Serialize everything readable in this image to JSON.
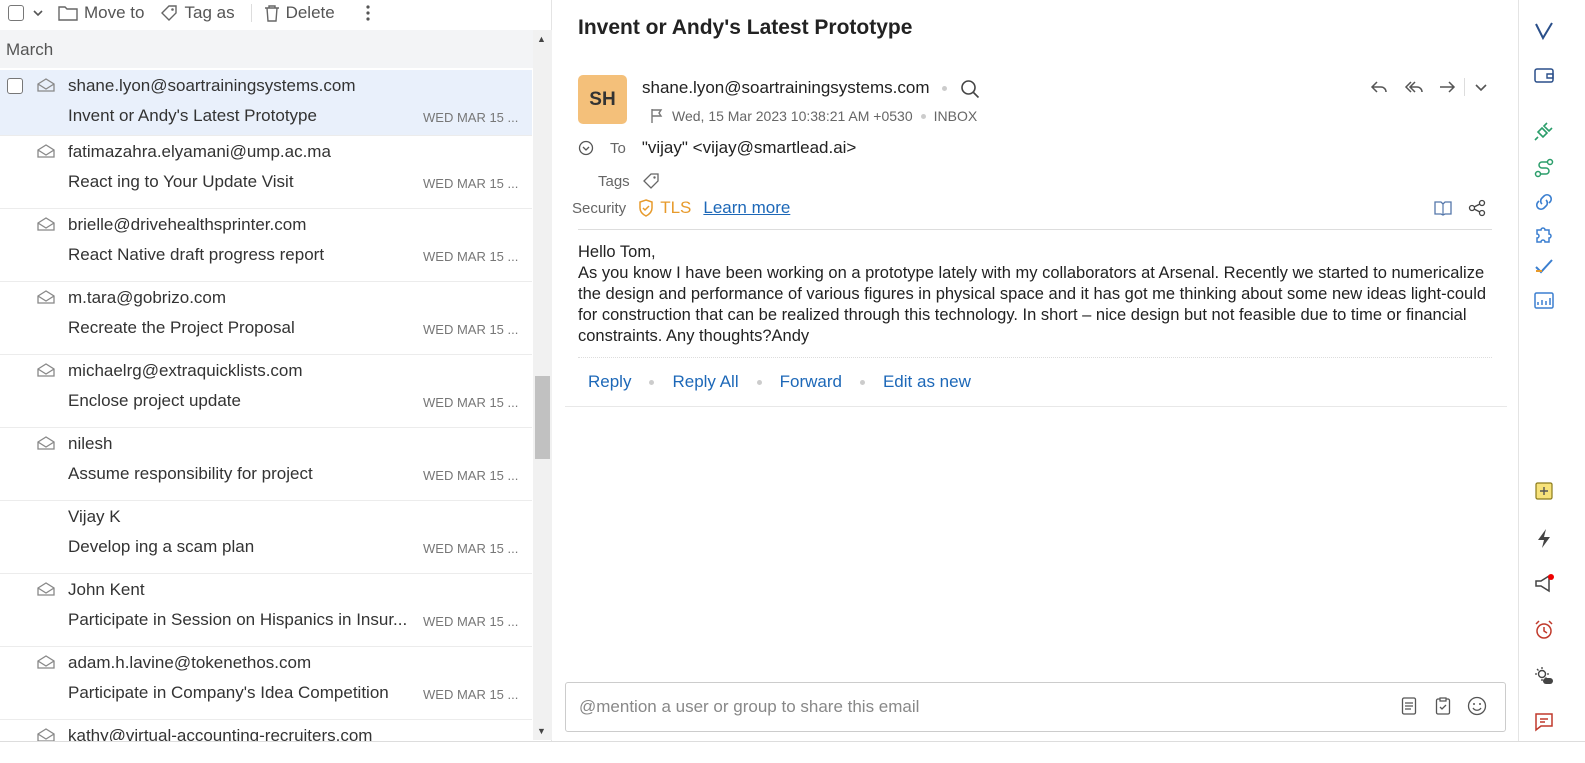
{
  "toolbar": {
    "move_label": "Move to",
    "tag_label": "Tag as",
    "delete_label": "Delete"
  },
  "list": {
    "group_label": "March",
    "emails": [
      {
        "from": "shane.lyon@soartrainingsystems.com",
        "subject": "Invent or Andy's Latest Prototype",
        "date": "WED MAR 15 ..."
      },
      {
        "from": "fatimazahra.elyamani@ump.ac.ma",
        "subject": "React ing to Your Update Visit",
        "date": "WED MAR 15 ..."
      },
      {
        "from": "brielle@drivehealthsprinter.com",
        "subject": "React Native draft progress report",
        "date": "WED MAR 15 ..."
      },
      {
        "from": "m.tara@gobrizo.com",
        "subject": "Recreate the Project Proposal",
        "date": "WED MAR 15 ..."
      },
      {
        "from": "michaelrg@extraquicklists.com",
        "subject": "Enclose project update",
        "date": "WED MAR 15 ..."
      },
      {
        "from": "nilesh",
        "subject": "Assume responsibility for project",
        "date": "WED MAR 15 ..."
      },
      {
        "from": "Vijay K",
        "subject": "Develop ing a scam plan",
        "date": "WED MAR 15 ..."
      },
      {
        "from": "John Kent",
        "subject": "Participate in Session on Hispanics in Insur...",
        "date": "WED MAR 15 ..."
      },
      {
        "from": "adam.h.lavine@tokenethos.com",
        "subject": "Participate in Company's Idea Competition",
        "date": "WED MAR 15 ..."
      },
      {
        "from": "kathy@virtual-accounting-recruiters.com",
        "subject": "",
        "date": ""
      }
    ]
  },
  "message": {
    "title": "Invent or Andy's Latest Prototype",
    "avatar_initials": "SH",
    "sender": "shane.lyon@soartrainingsystems.com",
    "date": "Wed, 15 Mar 2023 10:38:21 AM +0530",
    "folder": "INBOX",
    "to_label": "To",
    "to_value": "\"vijay\" <vijay@smartlead.ai>",
    "tags_label": "Tags",
    "security_label": "Security",
    "tls_label": "TLS",
    "learn_more": "Learn more",
    "greeting": "Hello Tom,",
    "body": "As you know I have been working on a prototype lately with my collaborators at Arsenal. Recently we started to numericalize the design and performance of various figures in physical space and it has got me thinking about some new ideas light-could for construction that can be realized through this technology. In short – nice design but not feasible due to time or financial constraints. Any thoughts?Andy",
    "actions": {
      "reply": "Reply",
      "reply_all": "Reply All",
      "forward": "Forward",
      "edit_as_new": "Edit as new"
    },
    "share_placeholder": "@mention a user or group to share this email"
  },
  "colors": {
    "accent": "#1d68b8",
    "avatar_bg": "#f4c07a",
    "tls": "#e79a2b",
    "selected_row": "#e9f0fb"
  }
}
